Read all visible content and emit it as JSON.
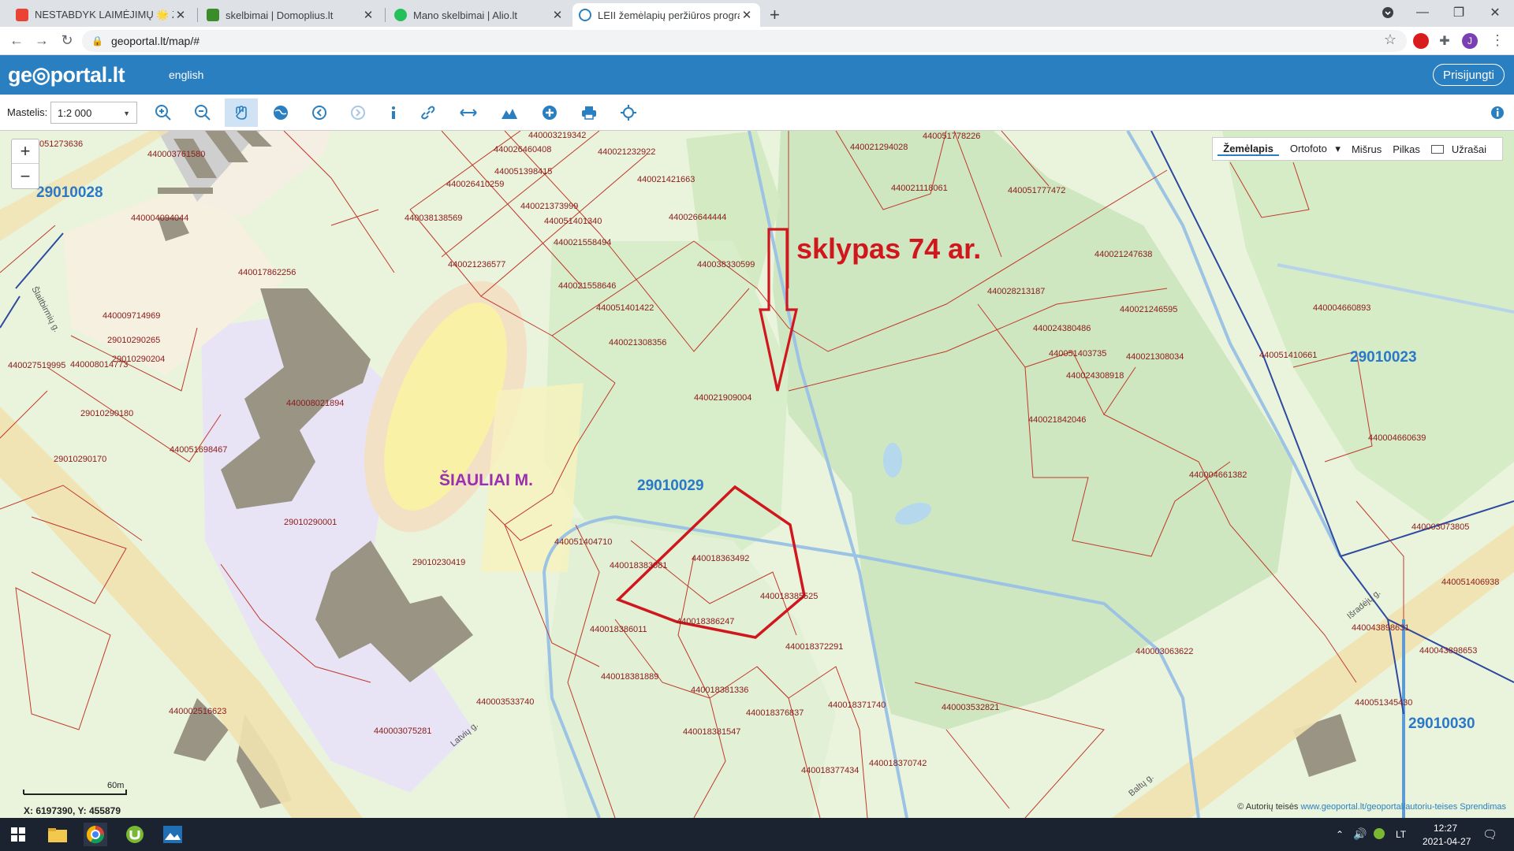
{
  "browser": {
    "tabs": [
      {
        "label": "NESTABDYK LAIMĖJIMŲ 🌟 Žai",
        "active": false
      },
      {
        "label": "skelbimai | Domoplius.lt",
        "active": false
      },
      {
        "label": "Mano skelbimai | Alio.lt",
        "active": false
      },
      {
        "label": "LEII žemėlapių peržiūros program",
        "active": true
      }
    ],
    "url": "geoportal.lt/map/#",
    "profile_initial": "J"
  },
  "header": {
    "logo": "ge◎portal.lt",
    "lang": "english",
    "login": "Prisijungti"
  },
  "toolbar": {
    "scale_label": "Mastelis:",
    "scale_value": "1:2 000",
    "tools": [
      "zoom-in-icon",
      "zoom-out-icon",
      "pan-icon",
      "globe-icon",
      "back-icon",
      "forward-icon",
      "info-icon",
      "link-icon",
      "measure-icon",
      "profile-icon",
      "add-icon",
      "print-icon",
      "locate-icon"
    ]
  },
  "map": {
    "layers": [
      "Žemėlapis",
      "Ortofoto",
      "Mišrus",
      "Pilkas"
    ],
    "selected_layer": "Žemėlapis",
    "notes_label": "Užrašai",
    "annotation": "sklypas 74 ar.",
    "city_label": "ŠIAULIAI M.",
    "blocks": [
      "29010028",
      "29010029",
      "29010023",
      "29010030"
    ],
    "parcels": [
      "440026460408",
      "440021232922",
      "440021421663",
      "440051398415",
      "440026410259",
      "440021373999",
      "440038138569",
      "440051401340",
      "440026644444",
      "440021558494",
      "440021236577",
      "440038330599",
      "440021558646",
      "440051401422",
      "440021308356",
      "440021909004",
      "440021294028",
      "440051778226",
      "440021118061",
      "440051777472",
      "440021247638",
      "440028213187",
      "440021246595",
      "440024380486",
      "440051403735",
      "440021308034",
      "440024308918",
      "440021842046",
      "440004661382",
      "440004660893",
      "440051410661",
      "440004660639",
      "440003073805",
      "440051406938",
      "440043898631",
      "440043898653",
      "440051345430",
      "440003063622",
      "440003532821",
      "440018370742",
      "440018377434",
      "440018381547",
      "440018376837",
      "440018371740",
      "440018372291",
      "440018381336",
      "440018381889",
      "440018386247",
      "440018386011",
      "440018385525",
      "440018363492",
      "440018383081",
      "440051404710",
      "440003533740",
      "440003075281",
      "440002516623",
      "440051698467",
      "29010290001",
      "29010230419",
      "440008021894",
      "440017862256",
      "440008014773",
      "440009714969",
      "29010290265",
      "29010290204",
      "29010290180",
      "29010290170",
      "440027519995",
      "440004094044",
      "440003761580",
      "051273636",
      "440003219342"
    ],
    "streets": [
      "Latvių g.",
      "Baltų g.",
      "Išradėjų g.",
      "Šlaitbirmių g."
    ],
    "scale_bar": "60m",
    "coords": "X: 6197390, Y: 455879",
    "copyright": "© Autorių teisės",
    "copyright_link": "www.geoportal.lt/geoportal/autoriu-teises",
    "decisions": "Sprendimas"
  },
  "taskbar": {
    "time": "12:27",
    "date": "2021-04-27",
    "lang": "LT"
  }
}
